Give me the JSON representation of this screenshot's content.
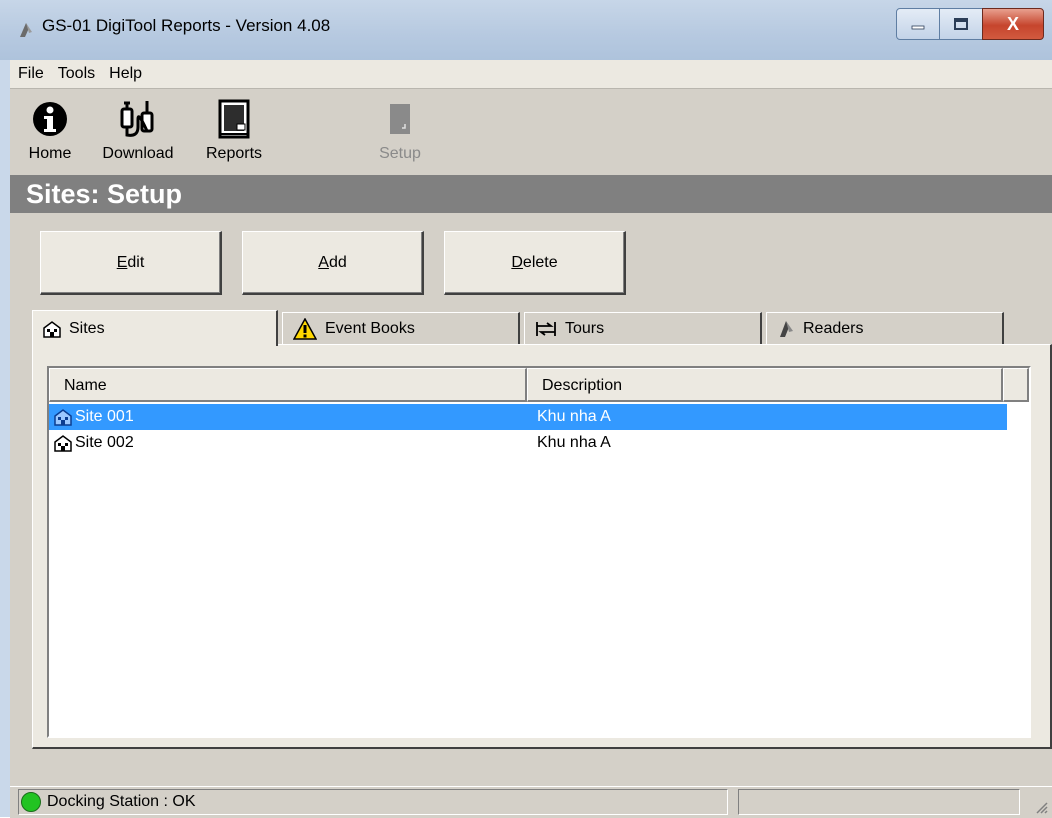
{
  "window": {
    "title": "GS-01 DigiTool Reports - Version 4.08",
    "buttons": {
      "minimize": "–",
      "maximize": "□",
      "close": "X"
    }
  },
  "menu": [
    "File",
    "Tools",
    "Help"
  ],
  "toolbar": {
    "home": "Home",
    "download": "Download",
    "reports": "Reports",
    "setup": "Setup"
  },
  "section": {
    "title": "Sites: Setup"
  },
  "actions": {
    "edit": {
      "mnemonic": "E",
      "rest": "dit"
    },
    "add": {
      "mnemonic": "A",
      "rest": "dd"
    },
    "delete": {
      "mnemonic": "D",
      "rest": "elete"
    }
  },
  "tabs": [
    {
      "label": "Sites",
      "icon": "building-icon",
      "active": true
    },
    {
      "label": "Event Books",
      "icon": "warning-icon",
      "active": false
    },
    {
      "label": "Tours",
      "icon": "tours-icon",
      "active": false
    },
    {
      "label": "Readers",
      "icon": "reader-icon",
      "active": false
    }
  ],
  "list": {
    "columns": [
      "Name",
      "Description"
    ],
    "rows": [
      {
        "name": "Site 001",
        "description": "Khu nha A",
        "selected": true
      },
      {
        "name": "Site 002",
        "description": "Khu nha A",
        "selected": false
      }
    ]
  },
  "status": {
    "text": "Docking Station : OK",
    "indicator_color": "#22c322"
  },
  "colors": {
    "selection": "#3399ff",
    "header_band": "#808080",
    "face": "#d4d0c8"
  }
}
